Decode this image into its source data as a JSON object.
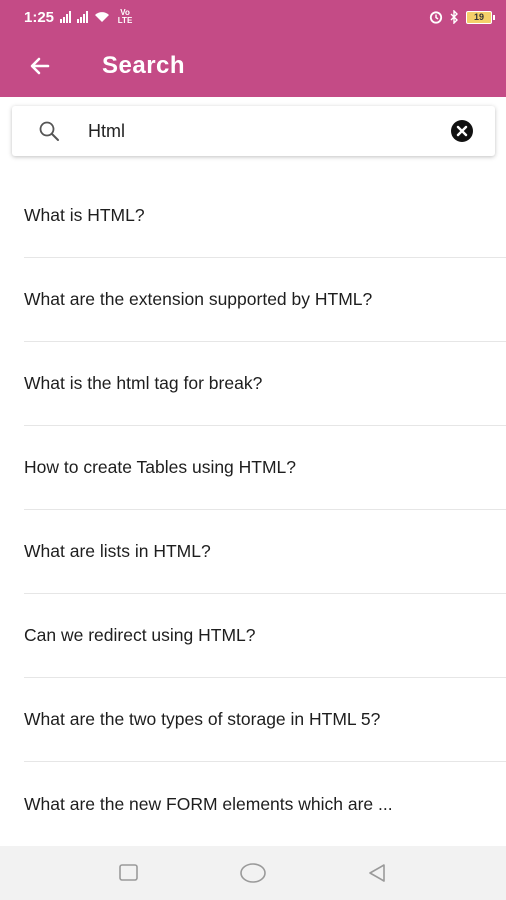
{
  "status_bar": {
    "time": "1:25",
    "network_label": "Vo LTE",
    "battery_level": "19"
  },
  "app_bar": {
    "title": "Search",
    "back_icon": "arrow-left-icon",
    "background_color": "#c44b86"
  },
  "search": {
    "value": "Html",
    "search_icon": "search-icon",
    "clear_icon": "clear-circle-icon"
  },
  "results": [
    {
      "text": "What is HTML?"
    },
    {
      "text": "What are the extension supported by HTML?"
    },
    {
      "text": "What is the html tag for break?"
    },
    {
      "text": "How to create Tables using HTML?"
    },
    {
      "text": "What are lists in HTML?"
    },
    {
      "text": "Can we redirect using HTML?"
    },
    {
      "text": "What are the two types of storage in HTML 5?"
    },
    {
      "text": "What are the new FORM elements which are ..."
    }
  ],
  "nav_bar": {
    "recent_icon": "square-icon",
    "home_icon": "circle-icon",
    "back_icon": "triangle-back-icon"
  }
}
